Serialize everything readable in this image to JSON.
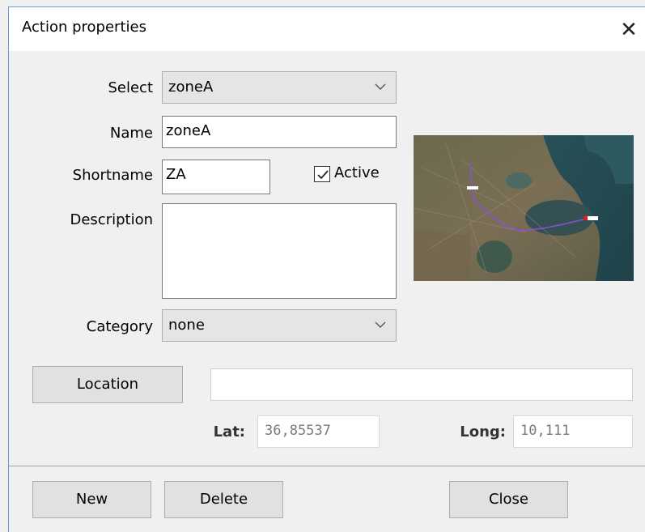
{
  "window": {
    "title": "Action properties",
    "close_glyph": "✕"
  },
  "form": {
    "select_label": "Select",
    "select_value": "zoneA",
    "name_label": "Name",
    "name_value": "zoneA",
    "shortname_label": "Shortname",
    "shortname_value": "ZA",
    "active_label": "Active",
    "active_checked": true,
    "description_label": "Description",
    "description_value": "",
    "category_label": "Category",
    "category_value": "none"
  },
  "location": {
    "button_label": "Location",
    "address_value": "",
    "lat_label": "Lat:",
    "lat_value": "36,85537",
    "long_label": "Long:",
    "long_value": "10,111"
  },
  "footer": {
    "new_label": "New",
    "delete_label": "Delete",
    "close_label": "Close"
  },
  "icons": {
    "dropdown": "chevron-down-icon",
    "check": "checkmark-icon",
    "close": "close-icon"
  },
  "colors": {
    "window_border": "#6a9bd1",
    "route_line": "#8c4fd6"
  }
}
